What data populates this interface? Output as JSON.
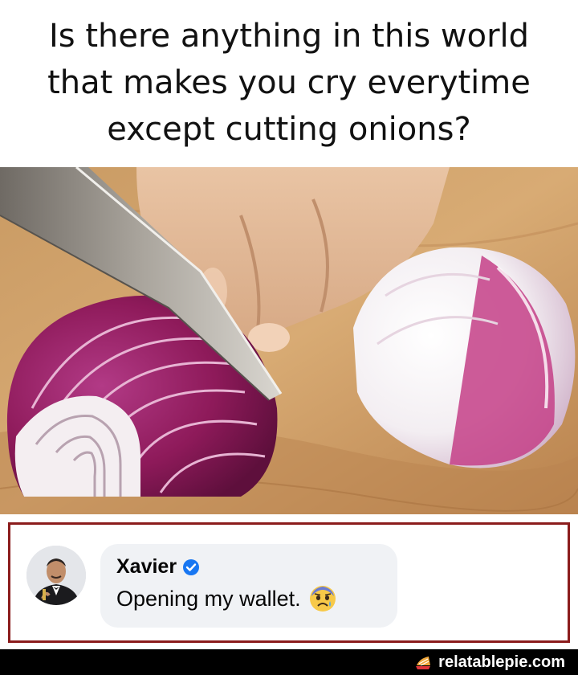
{
  "caption": {
    "text": "Is there anything in this world that makes you cry everytime except cutting onions?"
  },
  "comment": {
    "name": "Xavier",
    "text": "Opening my wallet.",
    "verified_icon": "verified-badge-icon",
    "emoji_icon": "anxious-face-emoji-icon"
  },
  "footer": {
    "brand": "relatablepie.com",
    "logo_icon": "pie-logo-icon"
  },
  "colors": {
    "frame": "#8b1c1c",
    "bubble": "#f0f2f5",
    "verified": "#1877f2",
    "onion": "#8e1a5a",
    "footer": "#000000"
  }
}
